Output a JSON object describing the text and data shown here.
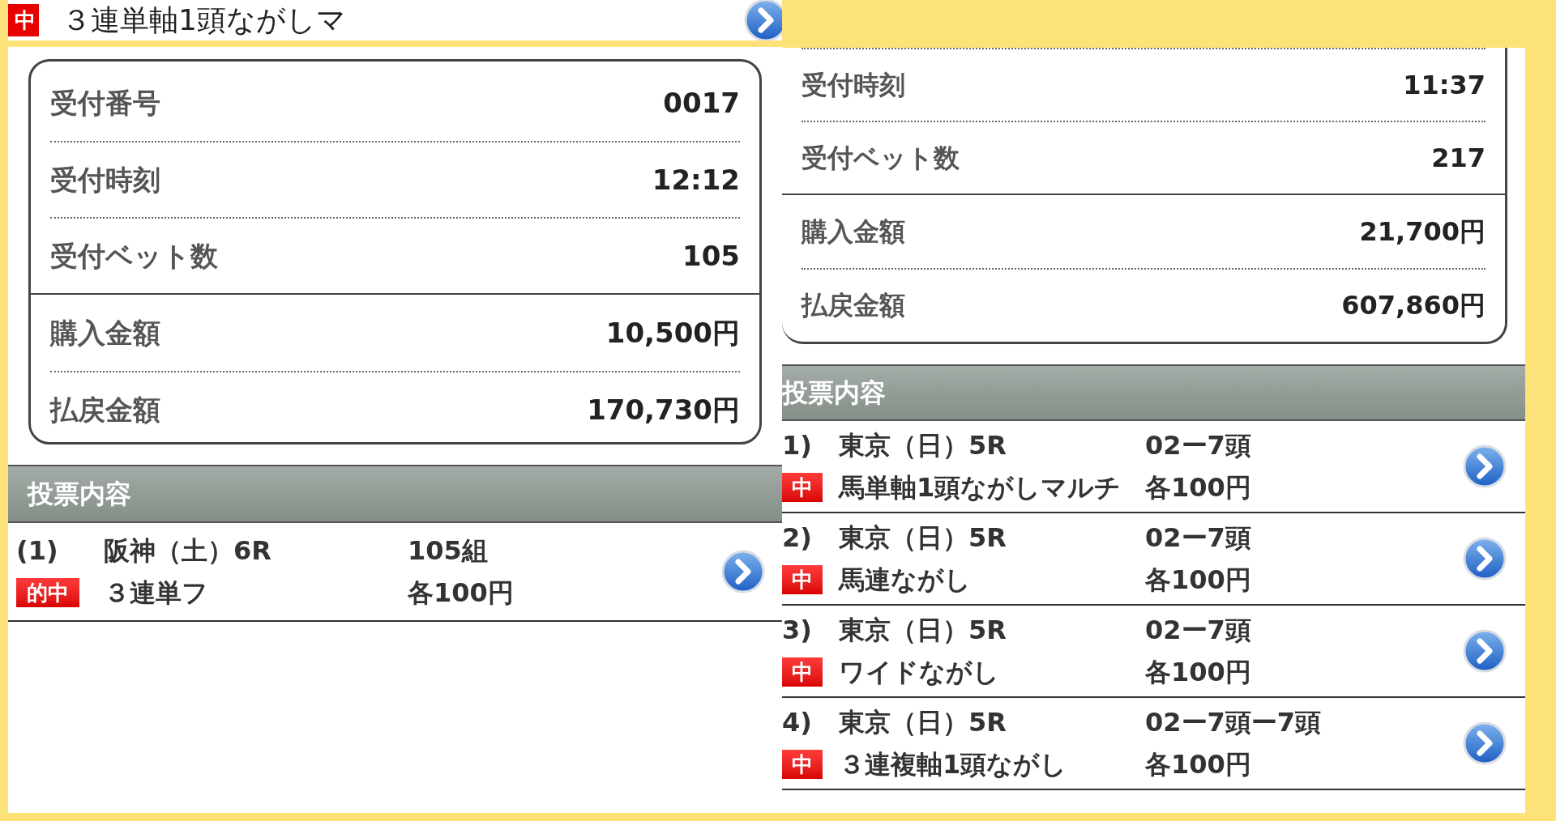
{
  "top_strip": {
    "badge": "中",
    "title": "３連単軸1頭ながしマ"
  },
  "left": {
    "groups": [
      [
        {
          "label": "受付番号",
          "value": "0017"
        },
        {
          "label": "受付時刻",
          "value": "12:12"
        },
        {
          "label": "受付ベット数",
          "value": "105"
        }
      ],
      [
        {
          "label": "購入金額",
          "value": "10,500円"
        },
        {
          "label": "払戻金額",
          "value": "170,730円"
        }
      ]
    ],
    "section_title": "投票内容",
    "bets": [
      {
        "number": "(1)",
        "race": "阪神（土）6R",
        "count": "105組",
        "badge": "的中",
        "type": "３連単フ",
        "unit": "各100円"
      }
    ]
  },
  "right": {
    "groups": [
      [
        {
          "label": "受付時刻",
          "value": "11:37"
        },
        {
          "label": "受付ベット数",
          "value": "217"
        }
      ],
      [
        {
          "label": "購入金額",
          "value": "21,700円"
        },
        {
          "label": "払戻金額",
          "value": "607,860円"
        }
      ]
    ],
    "section_title": "投票内容",
    "bets": [
      {
        "number": "1)",
        "race": "東京（日）5R",
        "count": "02ー7頭",
        "badge": "中",
        "type": "馬単軸1頭ながしマルチ",
        "unit": "各100円"
      },
      {
        "number": "2)",
        "race": "東京（日）5R",
        "count": "02ー7頭",
        "badge": "中",
        "type": "馬連ながし",
        "unit": "各100円"
      },
      {
        "number": "3)",
        "race": "東京（日）5R",
        "count": "02ー7頭",
        "badge": "中",
        "type": "ワイドながし",
        "unit": "各100円"
      },
      {
        "number": "4)",
        "race": "東京（日）5R",
        "count": "02ー7頭ー7頭",
        "badge": "中",
        "type": "３連複軸1頭ながし",
        "unit": "各100円"
      }
    ]
  }
}
